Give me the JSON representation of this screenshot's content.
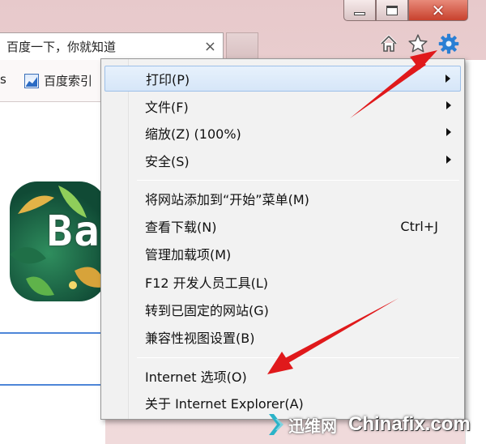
{
  "window": {
    "minimize_icon": "minimize-icon",
    "maximize_icon": "maximize-icon",
    "close_icon": "close-icon",
    "close_glyph": "✕"
  },
  "tab": {
    "title": "百度一下，你就知道",
    "close_glyph": "×"
  },
  "toolbar": {
    "home_icon": "home-icon",
    "favorites_icon": "star-icon",
    "tools_icon": "gear-icon",
    "tools_color": "#2a7fd4"
  },
  "favorites_bar": {
    "left_fragment": "s",
    "item_label": "百度索引"
  },
  "menu": {
    "items": [
      {
        "label": "打印(P)",
        "submenu": true,
        "highlighted": true
      },
      {
        "label": "文件(F)",
        "submenu": true
      },
      {
        "label": "缩放(Z) (100%)",
        "submenu": true
      },
      {
        "label": "安全(S)",
        "submenu": true
      },
      {
        "label": "将网站添加到“开始”菜单(M)"
      },
      {
        "label": "查看下载(N)",
        "shortcut": "Ctrl+J"
      },
      {
        "label": "管理加载项(M)"
      },
      {
        "label": "F12 开发人员工具(L)"
      },
      {
        "label": "转到已固定的网站(G)"
      },
      {
        "label": "兼容性视图设置(B)"
      },
      {
        "label": "Internet 选项(O)"
      },
      {
        "label": "关于 Internet Explorer(A)"
      }
    ]
  },
  "watermark": {
    "cn": "迅维网",
    "en": "Chinafix.com"
  },
  "colors": {
    "annotation_arrow": "#e0191b",
    "highlight": "#d6e6f8"
  }
}
